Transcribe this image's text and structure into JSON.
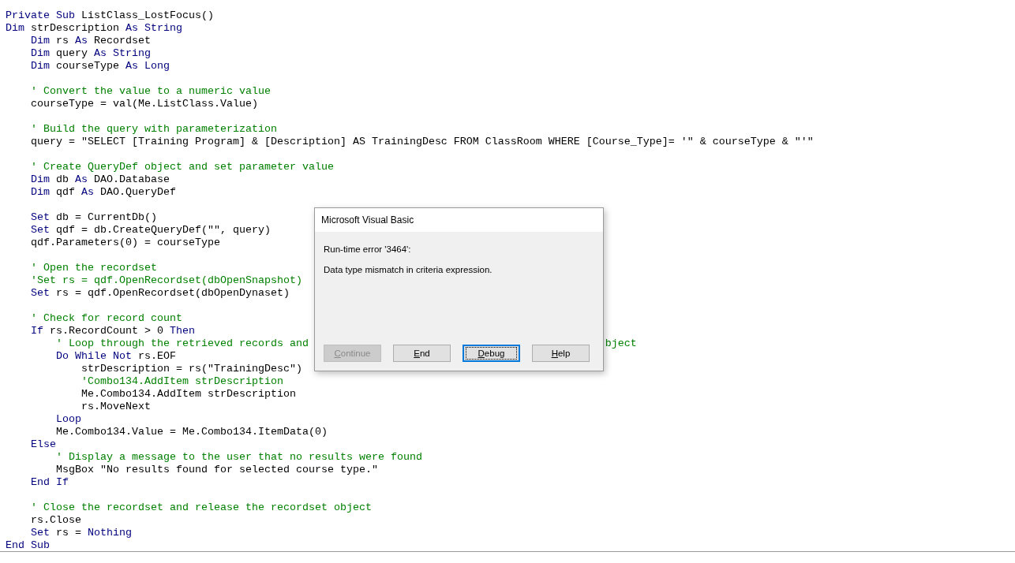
{
  "code_lines": [
    {
      "kind": "code",
      "segments": [
        {
          "kind": "keyword",
          "text": "Private Sub"
        },
        {
          "kind": "plain",
          "text": " ListClass_LostFocus()"
        }
      ]
    },
    {
      "kind": "code",
      "segments": [
        {
          "kind": "keyword",
          "text": "Dim"
        },
        {
          "kind": "plain",
          "text": " strDescription "
        },
        {
          "kind": "keyword",
          "text": "As String"
        }
      ]
    },
    {
      "kind": "code",
      "segments": [
        {
          "kind": "keyword",
          "text": "    Dim"
        },
        {
          "kind": "plain",
          "text": " rs "
        },
        {
          "kind": "keyword",
          "text": "As"
        },
        {
          "kind": "plain",
          "text": " Recordset"
        }
      ]
    },
    {
      "kind": "code",
      "segments": [
        {
          "kind": "keyword",
          "text": "    Dim"
        },
        {
          "kind": "plain",
          "text": " query "
        },
        {
          "kind": "keyword",
          "text": "As String"
        }
      ]
    },
    {
      "kind": "code",
      "segments": [
        {
          "kind": "keyword",
          "text": "    Dim"
        },
        {
          "kind": "plain",
          "text": " courseType "
        },
        {
          "kind": "keyword",
          "text": "As Long"
        }
      ]
    },
    {
      "kind": "blank"
    },
    {
      "kind": "comment",
      "text": "    ' Convert the value to a numeric value"
    },
    {
      "kind": "code",
      "segments": [
        {
          "kind": "plain",
          "text": "    courseType = val(Me.ListClass.Value)"
        }
      ]
    },
    {
      "kind": "blank"
    },
    {
      "kind": "comment",
      "text": "    ' Build the query with parameterization"
    },
    {
      "kind": "code",
      "segments": [
        {
          "kind": "plain",
          "text": "    query = \"SELECT [Training Program] & [Description] AS TrainingDesc FROM ClassRoom WHERE [Course_Type]= '\" & courseType & \"'\""
        }
      ]
    },
    {
      "kind": "blank"
    },
    {
      "kind": "comment",
      "text": "    ' Create QueryDef object and set parameter value"
    },
    {
      "kind": "code",
      "segments": [
        {
          "kind": "keyword",
          "text": "    Dim"
        },
        {
          "kind": "plain",
          "text": " db "
        },
        {
          "kind": "keyword",
          "text": "As"
        },
        {
          "kind": "plain",
          "text": " DAO.Database"
        }
      ]
    },
    {
      "kind": "code",
      "segments": [
        {
          "kind": "keyword",
          "text": "    Dim"
        },
        {
          "kind": "plain",
          "text": " qdf "
        },
        {
          "kind": "keyword",
          "text": "As"
        },
        {
          "kind": "plain",
          "text": " DAO.QueryDef"
        }
      ]
    },
    {
      "kind": "blank"
    },
    {
      "kind": "code",
      "segments": [
        {
          "kind": "keyword",
          "text": "    Set"
        },
        {
          "kind": "plain",
          "text": " db = CurrentDb()"
        }
      ]
    },
    {
      "kind": "code",
      "segments": [
        {
          "kind": "keyword",
          "text": "    Set"
        },
        {
          "kind": "plain",
          "text": " qdf = db.CreateQueryDef(\"\", query)"
        }
      ]
    },
    {
      "kind": "code",
      "segments": [
        {
          "kind": "plain",
          "text": "    qdf.Parameters(0) = courseType"
        }
      ]
    },
    {
      "kind": "blank"
    },
    {
      "kind": "comment",
      "text": "    ' Open the recordset"
    },
    {
      "kind": "comment",
      "text": "    'Set rs = qdf.OpenRecordset(dbOpenSnapshot)"
    },
    {
      "kind": "code",
      "segments": [
        {
          "kind": "keyword",
          "text": "    Set"
        },
        {
          "kind": "plain",
          "text": " rs = qdf.OpenRecordset(dbOpenDynaset)"
        }
      ]
    },
    {
      "kind": "blank"
    },
    {
      "kind": "comment",
      "text": "    ' Check for record count"
    },
    {
      "kind": "code",
      "segments": [
        {
          "kind": "keyword",
          "text": "    If"
        },
        {
          "kind": "plain",
          "text": " rs.RecordCount > 0 "
        },
        {
          "kind": "keyword",
          "text": "Then"
        }
      ]
    },
    {
      "kind": "comment",
      "text": "        ' Loop through the retrieved records and",
      "tail": "bject"
    },
    {
      "kind": "code",
      "segments": [
        {
          "kind": "keyword",
          "text": "        Do While Not"
        },
        {
          "kind": "plain",
          "text": " rs.EOF"
        }
      ]
    },
    {
      "kind": "code",
      "segments": [
        {
          "kind": "plain",
          "text": "            strDescription = rs(\"TrainingDesc\")"
        }
      ]
    },
    {
      "kind": "comment",
      "text": "            'Combo134.AddItem strDescription"
    },
    {
      "kind": "code",
      "segments": [
        {
          "kind": "plain",
          "text": "            Me.Combo134.AddItem strDescription"
        }
      ]
    },
    {
      "kind": "code",
      "segments": [
        {
          "kind": "plain",
          "text": "            rs.MoveNext"
        }
      ]
    },
    {
      "kind": "code",
      "segments": [
        {
          "kind": "keyword",
          "text": "        Loop"
        }
      ]
    },
    {
      "kind": "code",
      "segments": [
        {
          "kind": "plain",
          "text": "        Me.Combo134.Value = Me.Combo134.ItemData(0)"
        }
      ]
    },
    {
      "kind": "code",
      "segments": [
        {
          "kind": "keyword",
          "text": "    Else"
        }
      ]
    },
    {
      "kind": "comment",
      "text": "        ' Display a message to the user that no results were found"
    },
    {
      "kind": "code",
      "segments": [
        {
          "kind": "plain",
          "text": "        MsgBox \"No results found for selected course type.\""
        }
      ]
    },
    {
      "kind": "code",
      "segments": [
        {
          "kind": "keyword",
          "text": "    End If"
        }
      ]
    },
    {
      "kind": "blank"
    },
    {
      "kind": "comment",
      "text": "    ' Close the recordset and release the recordset object"
    },
    {
      "kind": "code",
      "segments": [
        {
          "kind": "plain",
          "text": "    rs.Close"
        }
      ]
    },
    {
      "kind": "code",
      "segments": [
        {
          "kind": "keyword",
          "text": "    Set"
        },
        {
          "kind": "plain",
          "text": " rs = "
        },
        {
          "kind": "keyword",
          "text": "Nothing"
        }
      ]
    },
    {
      "kind": "code",
      "segments": [
        {
          "kind": "keyword",
          "text": "End Sub"
        }
      ]
    }
  ],
  "dialog": {
    "title": "Microsoft Visual Basic",
    "error": "Run-time error '3464':",
    "message": "Data type mismatch in criteria expression.",
    "buttons": [
      {
        "key": "C",
        "rest": "ontinue",
        "disabled": true,
        "focused": false
      },
      {
        "key": "E",
        "rest": "nd",
        "disabled": false,
        "focused": false
      },
      {
        "key": "D",
        "rest": "ebug",
        "disabled": false,
        "focused": true
      },
      {
        "key": "H",
        "rest": "elp",
        "disabled": false,
        "focused": false
      }
    ]
  }
}
